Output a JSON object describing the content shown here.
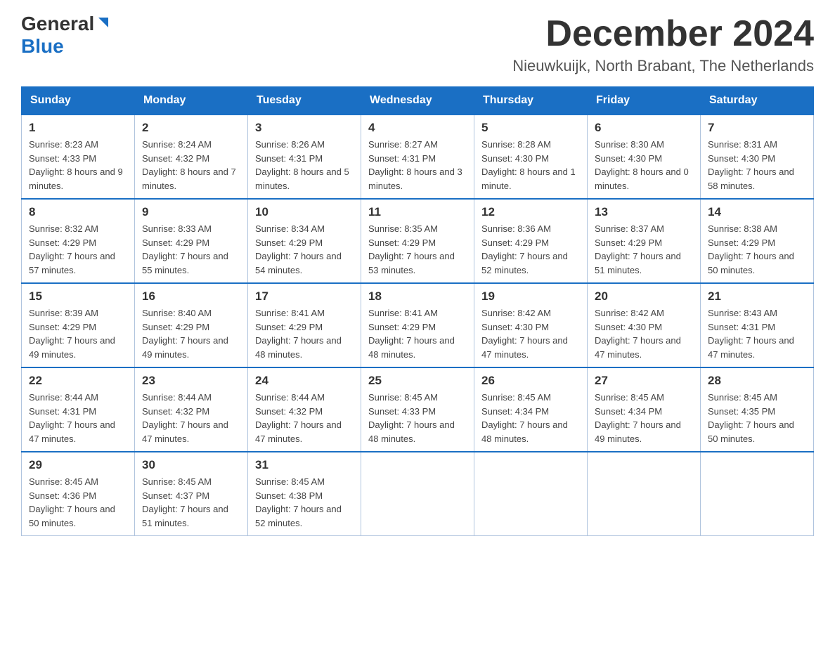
{
  "header": {
    "logo_general": "General",
    "logo_blue": "Blue",
    "main_title": "December 2024",
    "subtitle": "Nieuwkuijk, North Brabant, The Netherlands"
  },
  "days_of_week": [
    "Sunday",
    "Monday",
    "Tuesday",
    "Wednesday",
    "Thursday",
    "Friday",
    "Saturday"
  ],
  "weeks": [
    [
      {
        "day": "1",
        "sunrise": "8:23 AM",
        "sunset": "4:33 PM",
        "daylight": "8 hours and 9 minutes."
      },
      {
        "day": "2",
        "sunrise": "8:24 AM",
        "sunset": "4:32 PM",
        "daylight": "8 hours and 7 minutes."
      },
      {
        "day": "3",
        "sunrise": "8:26 AM",
        "sunset": "4:31 PM",
        "daylight": "8 hours and 5 minutes."
      },
      {
        "day": "4",
        "sunrise": "8:27 AM",
        "sunset": "4:31 PM",
        "daylight": "8 hours and 3 minutes."
      },
      {
        "day": "5",
        "sunrise": "8:28 AM",
        "sunset": "4:30 PM",
        "daylight": "8 hours and 1 minute."
      },
      {
        "day": "6",
        "sunrise": "8:30 AM",
        "sunset": "4:30 PM",
        "daylight": "8 hours and 0 minutes."
      },
      {
        "day": "7",
        "sunrise": "8:31 AM",
        "sunset": "4:30 PM",
        "daylight": "7 hours and 58 minutes."
      }
    ],
    [
      {
        "day": "8",
        "sunrise": "8:32 AM",
        "sunset": "4:29 PM",
        "daylight": "7 hours and 57 minutes."
      },
      {
        "day": "9",
        "sunrise": "8:33 AM",
        "sunset": "4:29 PM",
        "daylight": "7 hours and 55 minutes."
      },
      {
        "day": "10",
        "sunrise": "8:34 AM",
        "sunset": "4:29 PM",
        "daylight": "7 hours and 54 minutes."
      },
      {
        "day": "11",
        "sunrise": "8:35 AM",
        "sunset": "4:29 PM",
        "daylight": "7 hours and 53 minutes."
      },
      {
        "day": "12",
        "sunrise": "8:36 AM",
        "sunset": "4:29 PM",
        "daylight": "7 hours and 52 minutes."
      },
      {
        "day": "13",
        "sunrise": "8:37 AM",
        "sunset": "4:29 PM",
        "daylight": "7 hours and 51 minutes."
      },
      {
        "day": "14",
        "sunrise": "8:38 AM",
        "sunset": "4:29 PM",
        "daylight": "7 hours and 50 minutes."
      }
    ],
    [
      {
        "day": "15",
        "sunrise": "8:39 AM",
        "sunset": "4:29 PM",
        "daylight": "7 hours and 49 minutes."
      },
      {
        "day": "16",
        "sunrise": "8:40 AM",
        "sunset": "4:29 PM",
        "daylight": "7 hours and 49 minutes."
      },
      {
        "day": "17",
        "sunrise": "8:41 AM",
        "sunset": "4:29 PM",
        "daylight": "7 hours and 48 minutes."
      },
      {
        "day": "18",
        "sunrise": "8:41 AM",
        "sunset": "4:29 PM",
        "daylight": "7 hours and 48 minutes."
      },
      {
        "day": "19",
        "sunrise": "8:42 AM",
        "sunset": "4:30 PM",
        "daylight": "7 hours and 47 minutes."
      },
      {
        "day": "20",
        "sunrise": "8:42 AM",
        "sunset": "4:30 PM",
        "daylight": "7 hours and 47 minutes."
      },
      {
        "day": "21",
        "sunrise": "8:43 AM",
        "sunset": "4:31 PM",
        "daylight": "7 hours and 47 minutes."
      }
    ],
    [
      {
        "day": "22",
        "sunrise": "8:44 AM",
        "sunset": "4:31 PM",
        "daylight": "7 hours and 47 minutes."
      },
      {
        "day": "23",
        "sunrise": "8:44 AM",
        "sunset": "4:32 PM",
        "daylight": "7 hours and 47 minutes."
      },
      {
        "day": "24",
        "sunrise": "8:44 AM",
        "sunset": "4:32 PM",
        "daylight": "7 hours and 47 minutes."
      },
      {
        "day": "25",
        "sunrise": "8:45 AM",
        "sunset": "4:33 PM",
        "daylight": "7 hours and 48 minutes."
      },
      {
        "day": "26",
        "sunrise": "8:45 AM",
        "sunset": "4:34 PM",
        "daylight": "7 hours and 48 minutes."
      },
      {
        "day": "27",
        "sunrise": "8:45 AM",
        "sunset": "4:34 PM",
        "daylight": "7 hours and 49 minutes."
      },
      {
        "day": "28",
        "sunrise": "8:45 AM",
        "sunset": "4:35 PM",
        "daylight": "7 hours and 50 minutes."
      }
    ],
    [
      {
        "day": "29",
        "sunrise": "8:45 AM",
        "sunset": "4:36 PM",
        "daylight": "7 hours and 50 minutes."
      },
      {
        "day": "30",
        "sunrise": "8:45 AM",
        "sunset": "4:37 PM",
        "daylight": "7 hours and 51 minutes."
      },
      {
        "day": "31",
        "sunrise": "8:45 AM",
        "sunset": "4:38 PM",
        "daylight": "7 hours and 52 minutes."
      },
      null,
      null,
      null,
      null
    ]
  ]
}
